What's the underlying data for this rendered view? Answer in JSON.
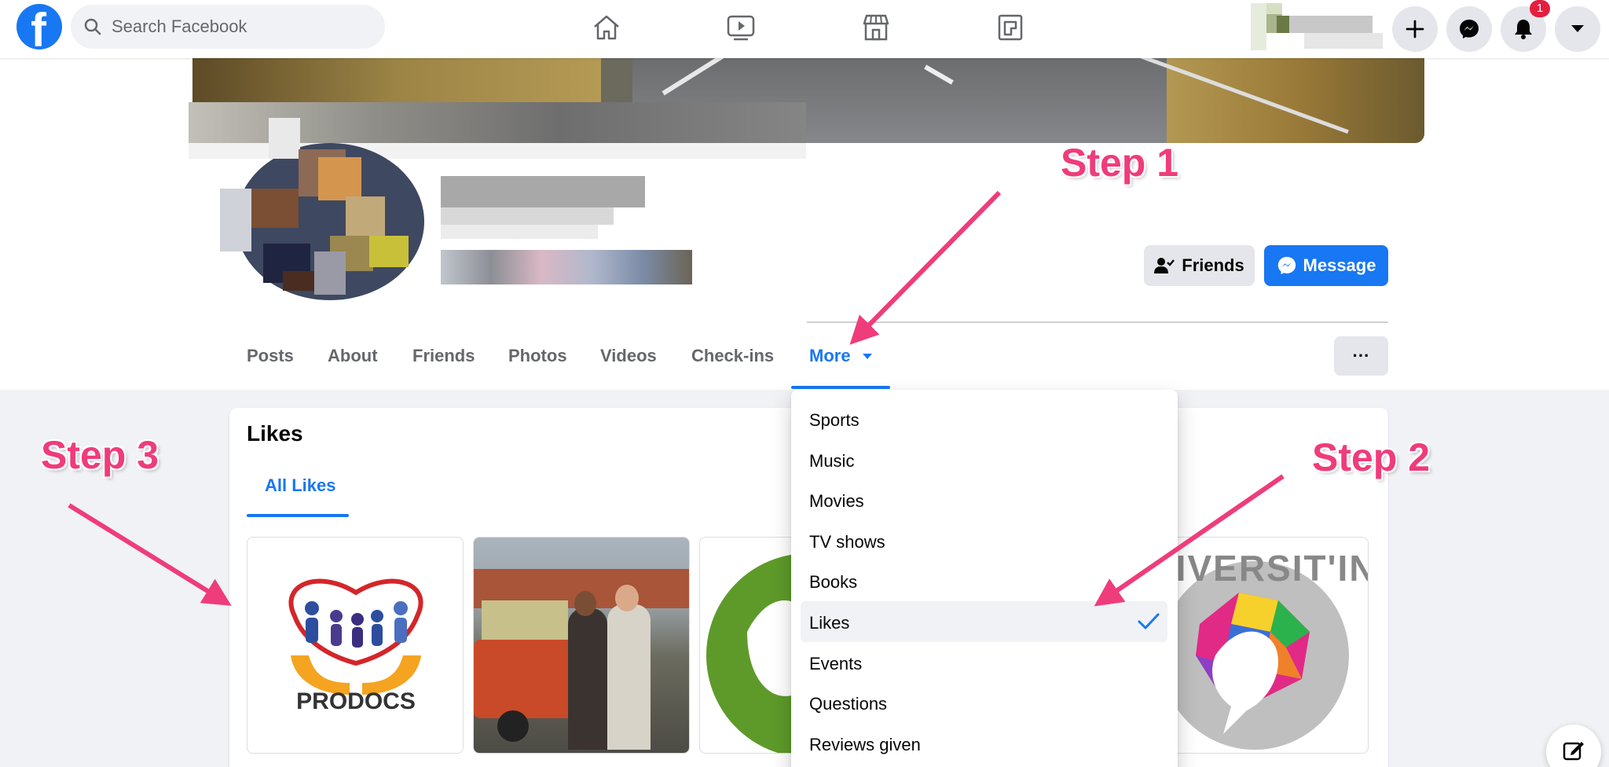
{
  "topbar": {
    "logo_letter": "f",
    "search_placeholder": "Search Facebook",
    "notification_count": "1",
    "nav_icons": [
      "home-icon",
      "watch-icon",
      "marketplace-icon",
      "gaming-icon"
    ],
    "right_icons": [
      "plus-icon",
      "messenger-icon",
      "bell-icon",
      "caret-down-icon"
    ]
  },
  "profile": {
    "friends_button": "Friends",
    "message_button": "Message",
    "more_options_label": "···"
  },
  "tabs": [
    "Posts",
    "About",
    "Friends",
    "Photos",
    "Videos",
    "Check-ins",
    "More"
  ],
  "likes_section": {
    "title": "Likes",
    "subtab": "All Likes",
    "tiles": [
      "PRODOCS",
      "",
      "",
      "DIVERSIT'IN"
    ]
  },
  "more_menu": {
    "items": [
      "Sports",
      "Music",
      "Movies",
      "TV shows",
      "Books",
      "Likes",
      "Events",
      "Questions",
      "Reviews given"
    ],
    "selected": "Likes"
  },
  "annotations": {
    "step1": "Step 1",
    "step2": "Step 2",
    "step3": "Step 3"
  },
  "colors": {
    "brand": "#1877f2",
    "annotation": "#ef3c7a",
    "badge": "#e41e3f"
  }
}
